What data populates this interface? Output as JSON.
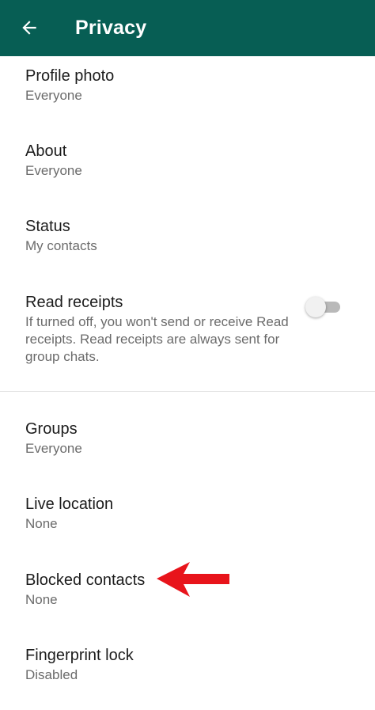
{
  "header": {
    "title": "Privacy",
    "background": "#075e54",
    "back_icon": "arrow-left-icon"
  },
  "settings": [
    {
      "title": "Profile photo",
      "value": "Everyone"
    },
    {
      "title": "About",
      "value": "Everyone"
    },
    {
      "title": "Status",
      "value": "My contacts"
    },
    {
      "title": "Read receipts",
      "description": "If turned off, you won't send or receive Read receipts. Read receipts are always sent for group chats.",
      "toggle_on": false
    },
    {
      "title": "Groups",
      "value": "Everyone"
    },
    {
      "title": "Live location",
      "value": "None"
    },
    {
      "title": "Blocked contacts",
      "value": "None"
    },
    {
      "title": "Fingerprint lock",
      "value": "Disabled"
    }
  ],
  "annotation": {
    "type": "arrow",
    "color": "#e8141b",
    "target": "Blocked contacts"
  }
}
